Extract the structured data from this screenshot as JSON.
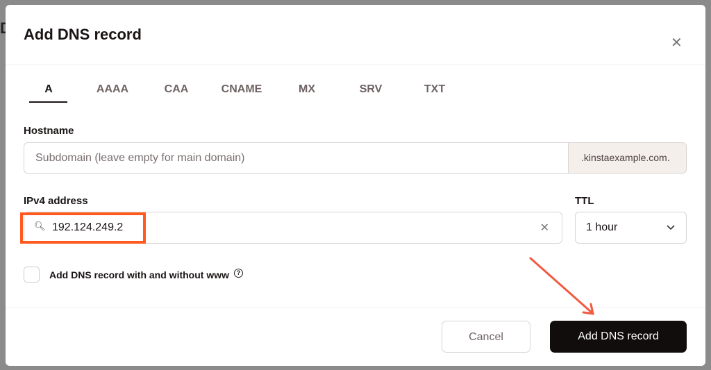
{
  "dialog": {
    "title": "Add DNS record",
    "close_icon": "close-icon"
  },
  "tabs": [
    {
      "label": "A"
    },
    {
      "label": "AAAA"
    },
    {
      "label": "CAA"
    },
    {
      "label": "CNAME"
    },
    {
      "label": "MX"
    },
    {
      "label": "SRV"
    },
    {
      "label": "TXT"
    }
  ],
  "hostname": {
    "label": "Hostname",
    "placeholder": "Subdomain (leave empty for main domain)",
    "suffix": ".kinstaexample.com."
  },
  "ipv4": {
    "label": "IPv4 address",
    "value": "192.124.249.2"
  },
  "ttl": {
    "label": "TTL",
    "value": "1 hour"
  },
  "www_checkbox": {
    "label": "Add DNS record with and without www",
    "checked": false
  },
  "buttons": {
    "cancel": "Cancel",
    "submit": "Add DNS record"
  },
  "colors": {
    "highlight": "#ff5a1f",
    "primary": "#110d0d",
    "arrow": "#f15a40"
  }
}
